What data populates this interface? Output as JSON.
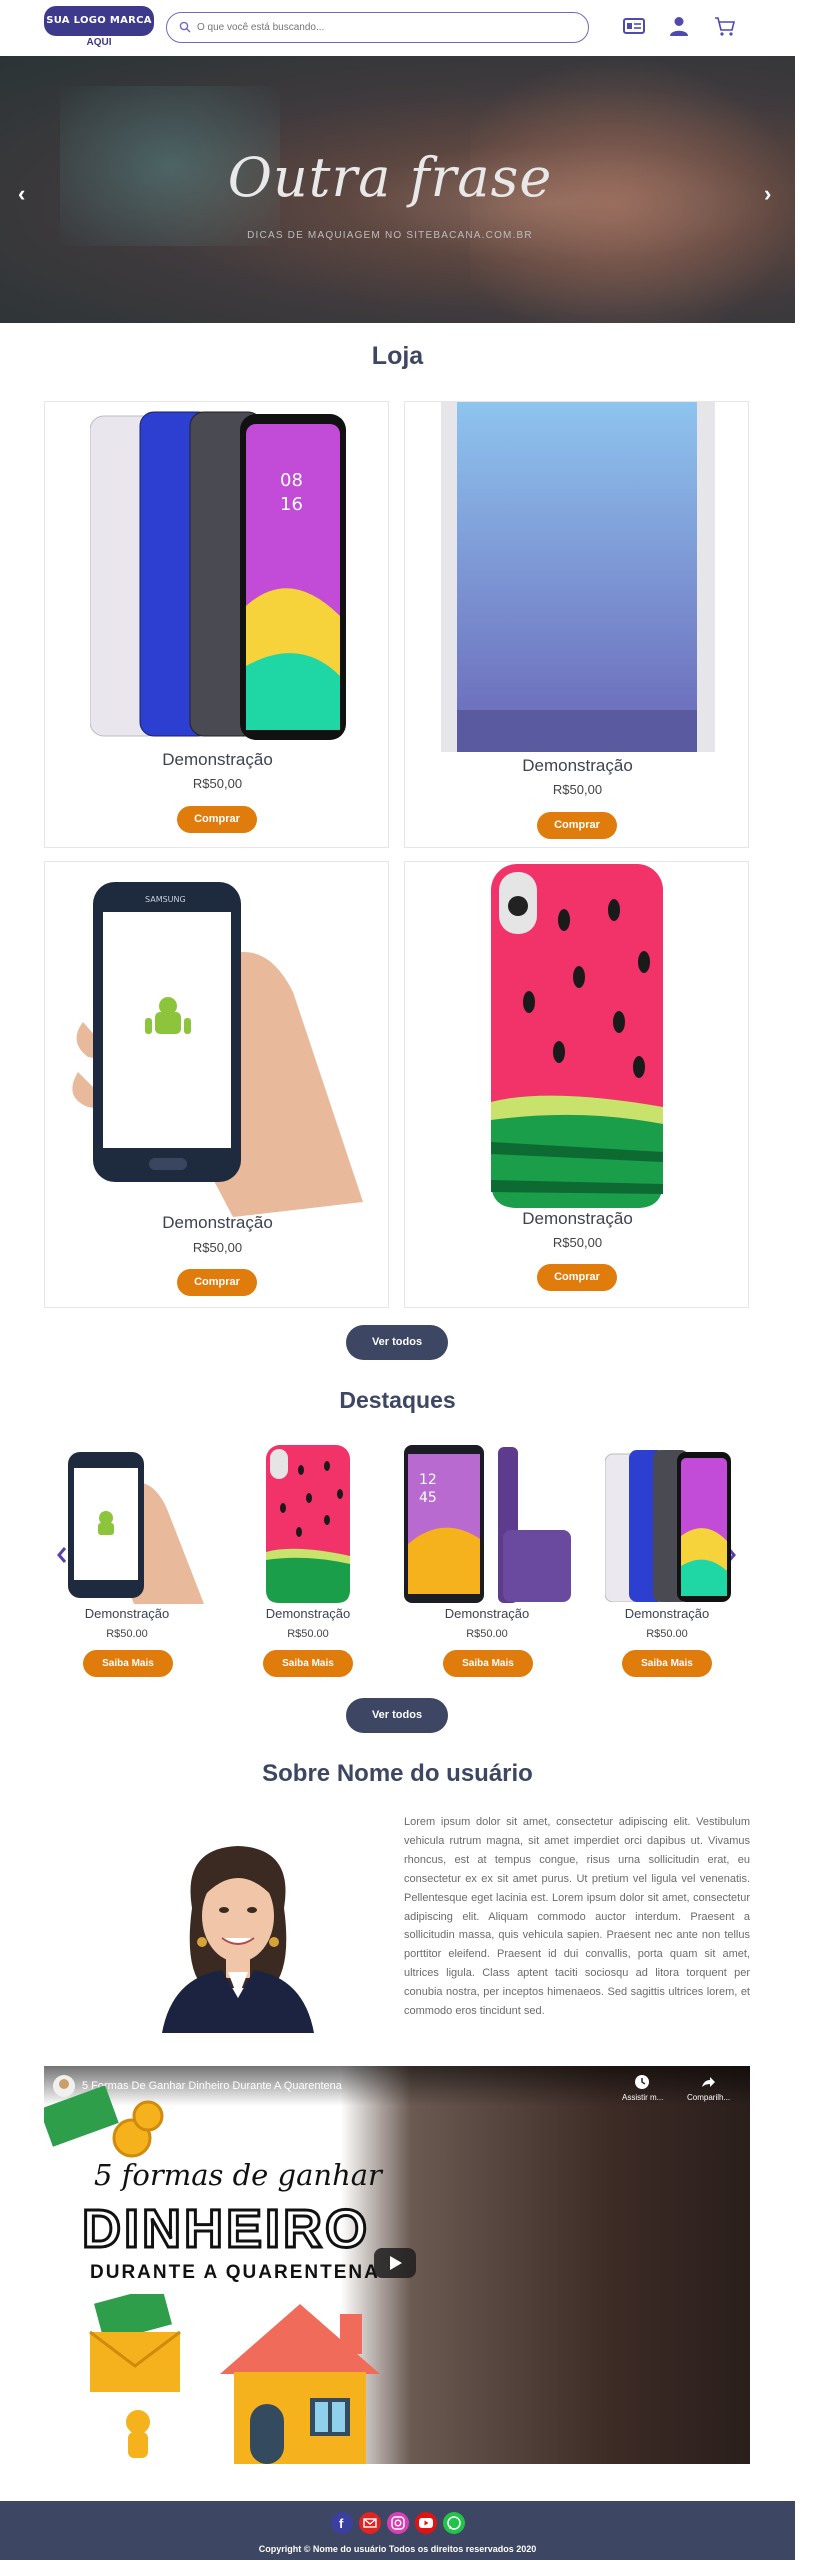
{
  "header": {
    "logo_line1": "SUA LOGO MARCA",
    "logo_line2": "AQUI",
    "search_placeholder": "O que você está buscando...",
    "icons": [
      "id-card-icon",
      "user-icon",
      "cart-icon"
    ]
  },
  "hero": {
    "title": "Outra frase",
    "subtitle": "DICAS DE MAQUIAGEM NO SITEBACANA.COM.BR",
    "prev": "‹",
    "next": "›"
  },
  "shop": {
    "heading": "Loja",
    "products": [
      {
        "name": "Demonstração",
        "price": "R$50,00",
        "button": "Comprar"
      },
      {
        "name": "Demonstração",
        "price": "R$50,00",
        "button": "Comprar"
      },
      {
        "name": "Demonstração",
        "price": "R$50,00",
        "button": "Comprar"
      },
      {
        "name": "Demonstração",
        "price": "R$50,00",
        "button": "Comprar"
      }
    ],
    "view_all": "Ver todos"
  },
  "featured": {
    "heading": "Destaques",
    "items": [
      {
        "name": "Demonstração",
        "price": "R$50.00",
        "button": "Saiba Mais"
      },
      {
        "name": "Demonstração",
        "price": "R$50.00",
        "button": "Saiba Mais"
      },
      {
        "name": "Demonstração",
        "price": "R$50.00",
        "button": "Saiba Mais"
      },
      {
        "name": "Demonstração",
        "price": "R$50.00",
        "button": "Saiba Mais"
      }
    ],
    "view_all": "Ver todos"
  },
  "about": {
    "heading": "Sobre Nome do usuário",
    "text": "Lorem ipsum dolor sit amet, consectetur adipiscing elit. Vestibulum vehicula rutrum magna, sit amet imperdiet orci dapibus ut. Vivamus rhoncus, est at tempus congue, risus urna sollicitudin erat, eu consectetur ex ex sit amet purus. Ut pretium vel ligula vel venenatis. Pellentesque eget lacinia est. Lorem ipsum dolor sit amet, consectetur adipiscing elit. Aliquam commodo auctor interdum. Praesent a sollicitudin massa, quis vehicula sapien. Praesent nec ante non tellus porttitor eleifend. Praesent id dui convallis, porta quam sit amet, ultrices ligula. Class aptent taciti sociosqu ad litora torquent per conubia nostra, per inceptos himenaeos. Sed sagittis ultrices lorem, et commodo eros tincidunt sed."
  },
  "video": {
    "title": "5 Formas De Ganhar Dinheiro Durante A Quarentena",
    "watch_later": "Assistir m...",
    "share": "Comparilh...",
    "line1": "5 formas de ganhar",
    "line2": "DINHEIRO",
    "line3": "DURANTE A QUARENTENA"
  },
  "footer": {
    "copyright": "Copyright © Nome do usuário Todos os direitos reservados 2020",
    "social": [
      "facebook-icon",
      "email-icon",
      "instagram-icon",
      "youtube-icon",
      "whatsapp-icon"
    ],
    "colors": {
      "facebook": "#3b3fa0",
      "email": "#e02424",
      "instagram": "#d93fb4",
      "youtube": "#e31212",
      "whatsapp": "#22c34a"
    }
  },
  "colors": {
    "accent_orange": "#e07c0b",
    "navy": "#3d4662",
    "logo_purple": "#3d3a8c"
  }
}
